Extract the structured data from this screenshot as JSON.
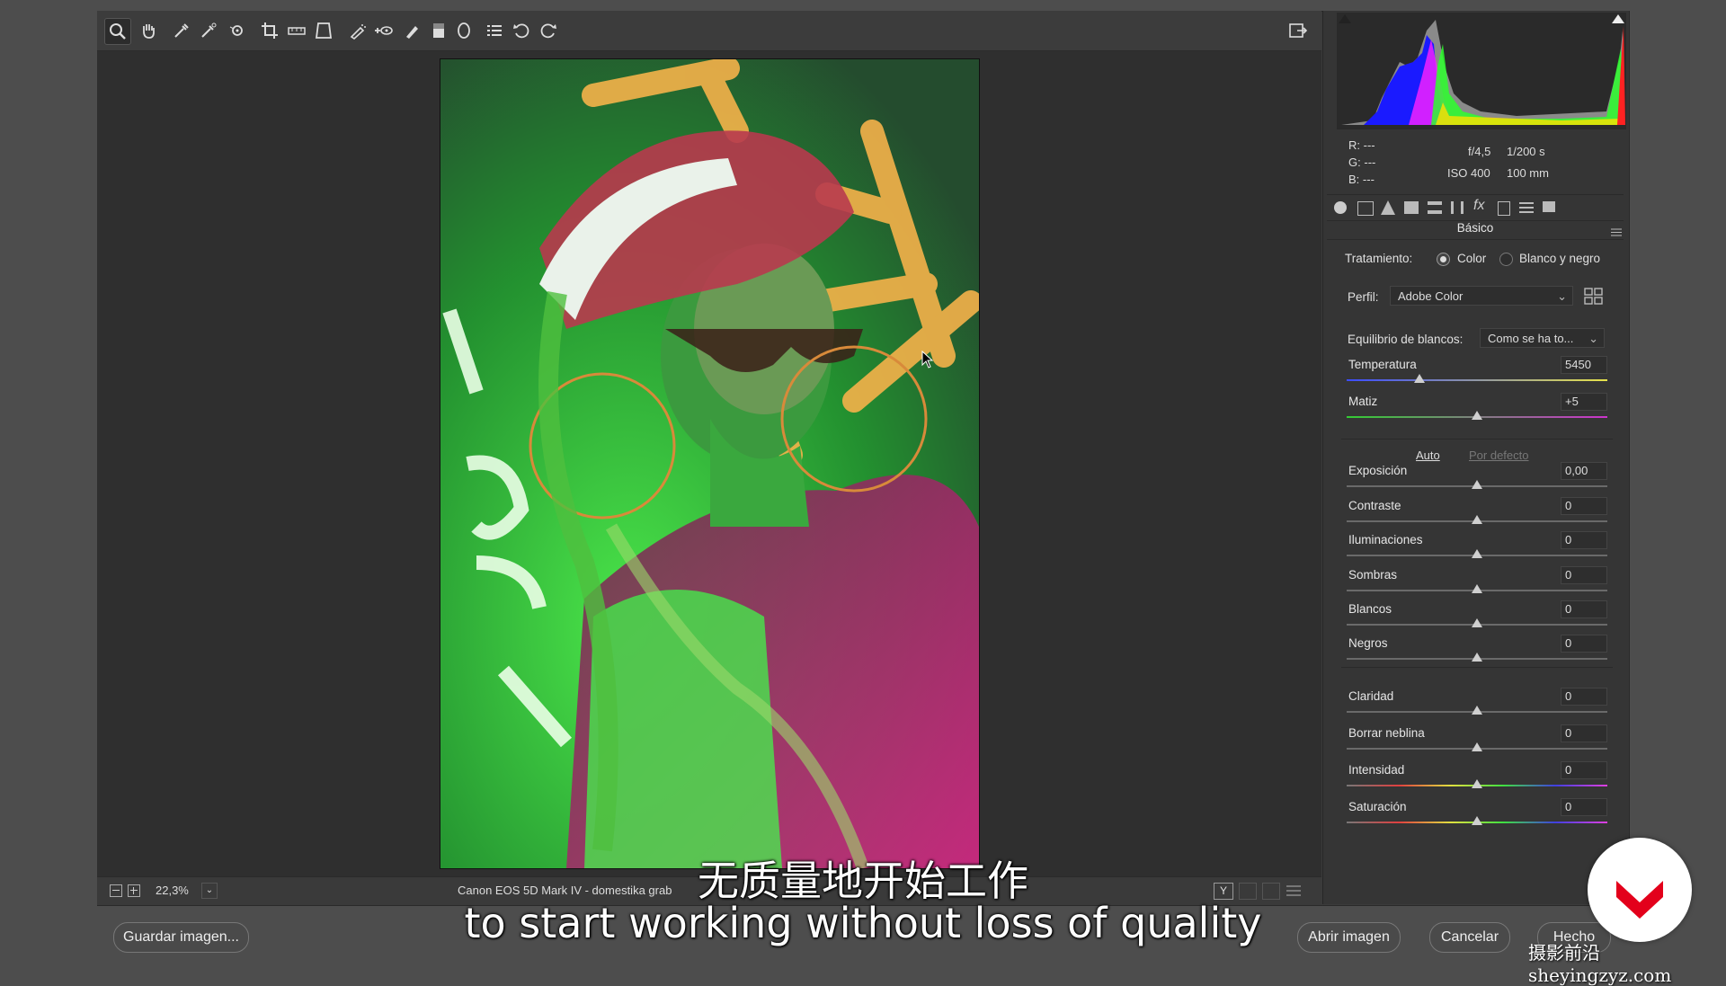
{
  "toolbar": {
    "tools": [
      "zoom-tool",
      "hand-tool",
      "white-balance-tool",
      "color-sampler-tool",
      "targeted-adjustment-tool",
      "crop-tool",
      "straighten-tool",
      "transform-tool",
      "spot-removal-tool",
      "red-eye-tool",
      "adjustment-brush-tool",
      "graduated-filter-tool",
      "radial-filter-tool",
      "presets-tool",
      "rotate-left-tool",
      "rotate-right-tool"
    ]
  },
  "histogram": {
    "readout": {
      "r_label": "R:",
      "g_label": "G:",
      "b_label": "B:",
      "r": "---",
      "g": "---",
      "b": "---"
    },
    "aperture": "f/4,5",
    "shutter": "1/200 s",
    "iso": "ISO 400",
    "focal": "100 mm"
  },
  "panel": {
    "title": "Básico",
    "treatment_label": "Tratamiento:",
    "treatment_color": "Color",
    "treatment_bw": "Blanco y negro",
    "profile_label": "Perfil:",
    "profile_value": "Adobe Color",
    "wb_label": "Equilibrio de blancos:",
    "wb_value": "Como se ha to...",
    "auto": "Auto",
    "default": "Por defecto",
    "sliders": [
      {
        "name": "Temperatura",
        "value": "5450",
        "pos": 0.28
      },
      {
        "name": "Matiz",
        "value": "+5",
        "pos": 0.5
      },
      {
        "name": "Exposición",
        "value": "0,00",
        "pos": 0.5
      },
      {
        "name": "Contraste",
        "value": "0",
        "pos": 0.5
      },
      {
        "name": "Iluminaciones",
        "value": "0",
        "pos": 0.5
      },
      {
        "name": "Sombras",
        "value": "0",
        "pos": 0.5
      },
      {
        "name": "Blancos",
        "value": "0",
        "pos": 0.5
      },
      {
        "name": "Negros",
        "value": "0",
        "pos": 0.5
      },
      {
        "name": "Claridad",
        "value": "0",
        "pos": 0.5
      },
      {
        "name": "Borrar neblina",
        "value": "0",
        "pos": 0.5
      },
      {
        "name": "Intensidad",
        "value": "0",
        "pos": 0.5
      },
      {
        "name": "Saturación",
        "value": "0",
        "pos": 0.5
      }
    ]
  },
  "status": {
    "zoom": "22,3%",
    "filename": "Canon EOS 5D Mark IV -  domestika grab"
  },
  "buttons": {
    "save": "Guardar imagen...",
    "open": "Abrir imagen",
    "cancel": "Cancelar",
    "done": "Hecho"
  },
  "subtitles": {
    "zh": "无质量地开始工作",
    "en": "to start working without loss of quality"
  },
  "watermark": "摄影前沿 sheyingzyz.com"
}
